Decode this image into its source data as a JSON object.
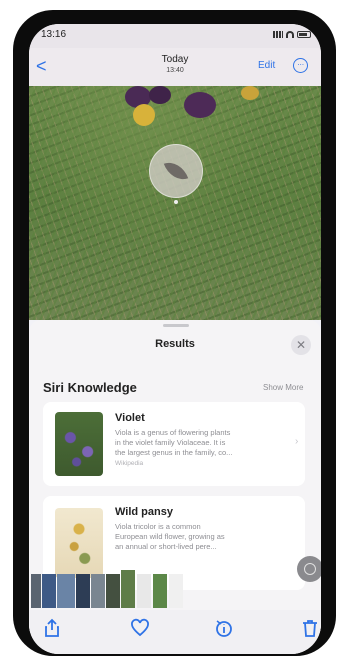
{
  "status_bar": {
    "time": "13:16"
  },
  "nav": {
    "back_label": "<",
    "title": "Today",
    "subtitle": "13:40",
    "edit_label": "Edit",
    "more_label": "···"
  },
  "sheet": {
    "title": "Results",
    "close_label": "✕",
    "section_title": "Siri Knowledge",
    "show_more_label": "Show More",
    "results": [
      {
        "title": "Violet",
        "lines": [
          "Viola is a genus of flowering plants",
          "in the violet family Violaceae. It is",
          "the largest genus in the family, co...",
          "Wikipedia"
        ]
      },
      {
        "title": "Wild pansy",
        "lines": [
          "Viola tricolor is a common",
          "European wild flower, growing as",
          "an annual or short-lived pere..."
        ]
      }
    ]
  },
  "toolbar": {
    "items": [
      "share",
      "favorite",
      "info",
      "delete"
    ]
  },
  "colors": {
    "accent": "#2f73e6",
    "sheet_bg": "#f5f4f6",
    "card_bg": "#ffffff"
  }
}
